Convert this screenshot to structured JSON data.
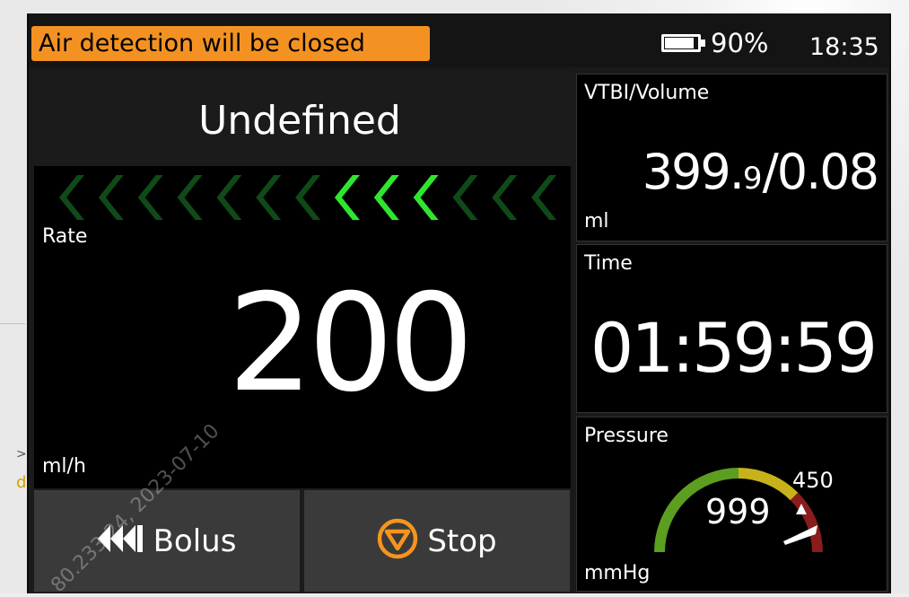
{
  "status_bar": {
    "alarm_message": "Air detection will be closed",
    "battery_percent_text": "90%",
    "battery_level": 0.9,
    "clock": "18:35"
  },
  "drug": {
    "name": "Undefined"
  },
  "rate": {
    "label": "Rate",
    "value": "200",
    "unit": "ml/h",
    "chevron_count": 13,
    "active_chevrons": [
      7,
      8,
      9
    ]
  },
  "buttons": {
    "bolus_label": "Bolus",
    "stop_label": "Stop"
  },
  "vtbi": {
    "title": "VTBI/Volume",
    "value_main": "399.",
    "value_decimal": "9",
    "value_rest": "/0.08",
    "unit": "ml"
  },
  "time": {
    "title": "Time",
    "value": "01:59:59"
  },
  "pressure": {
    "title": "Pressure",
    "value": "999",
    "limit": "450",
    "unit": "mmHg"
  },
  "watermark": {
    "text": "80.233.24, 2023-07-10"
  },
  "colors": {
    "alarm_banner": "#f39222",
    "chevron_active": "#2fe62f",
    "chevron_inactive": "#0f4a18",
    "stop_icon": "#f7941d",
    "gauge_green": "#5c9e1f",
    "gauge_yellow": "#c8b21c",
    "gauge_red": "#8a1c1c",
    "button_bg": "#3a3a3a",
    "panel_bg": "#000000"
  }
}
